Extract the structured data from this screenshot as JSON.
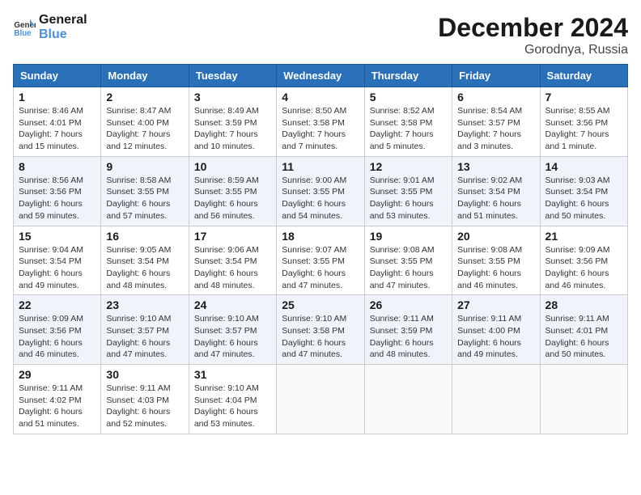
{
  "logo": {
    "line1": "General",
    "line2": "Blue"
  },
  "title": "December 2024",
  "location": "Gorodnya, Russia",
  "headers": [
    "Sunday",
    "Monday",
    "Tuesday",
    "Wednesday",
    "Thursday",
    "Friday",
    "Saturday"
  ],
  "weeks": [
    [
      {
        "day": "1",
        "info": "Sunrise: 8:46 AM\nSunset: 4:01 PM\nDaylight: 7 hours\nand 15 minutes."
      },
      {
        "day": "2",
        "info": "Sunrise: 8:47 AM\nSunset: 4:00 PM\nDaylight: 7 hours\nand 12 minutes."
      },
      {
        "day": "3",
        "info": "Sunrise: 8:49 AM\nSunset: 3:59 PM\nDaylight: 7 hours\nand 10 minutes."
      },
      {
        "day": "4",
        "info": "Sunrise: 8:50 AM\nSunset: 3:58 PM\nDaylight: 7 hours\nand 7 minutes."
      },
      {
        "day": "5",
        "info": "Sunrise: 8:52 AM\nSunset: 3:58 PM\nDaylight: 7 hours\nand 5 minutes."
      },
      {
        "day": "6",
        "info": "Sunrise: 8:54 AM\nSunset: 3:57 PM\nDaylight: 7 hours\nand 3 minutes."
      },
      {
        "day": "7",
        "info": "Sunrise: 8:55 AM\nSunset: 3:56 PM\nDaylight: 7 hours\nand 1 minute."
      }
    ],
    [
      {
        "day": "8",
        "info": "Sunrise: 8:56 AM\nSunset: 3:56 PM\nDaylight: 6 hours\nand 59 minutes."
      },
      {
        "day": "9",
        "info": "Sunrise: 8:58 AM\nSunset: 3:55 PM\nDaylight: 6 hours\nand 57 minutes."
      },
      {
        "day": "10",
        "info": "Sunrise: 8:59 AM\nSunset: 3:55 PM\nDaylight: 6 hours\nand 56 minutes."
      },
      {
        "day": "11",
        "info": "Sunrise: 9:00 AM\nSunset: 3:55 PM\nDaylight: 6 hours\nand 54 minutes."
      },
      {
        "day": "12",
        "info": "Sunrise: 9:01 AM\nSunset: 3:55 PM\nDaylight: 6 hours\nand 53 minutes."
      },
      {
        "day": "13",
        "info": "Sunrise: 9:02 AM\nSunset: 3:54 PM\nDaylight: 6 hours\nand 51 minutes."
      },
      {
        "day": "14",
        "info": "Sunrise: 9:03 AM\nSunset: 3:54 PM\nDaylight: 6 hours\nand 50 minutes."
      }
    ],
    [
      {
        "day": "15",
        "info": "Sunrise: 9:04 AM\nSunset: 3:54 PM\nDaylight: 6 hours\nand 49 minutes."
      },
      {
        "day": "16",
        "info": "Sunrise: 9:05 AM\nSunset: 3:54 PM\nDaylight: 6 hours\nand 48 minutes."
      },
      {
        "day": "17",
        "info": "Sunrise: 9:06 AM\nSunset: 3:54 PM\nDaylight: 6 hours\nand 48 minutes."
      },
      {
        "day": "18",
        "info": "Sunrise: 9:07 AM\nSunset: 3:55 PM\nDaylight: 6 hours\nand 47 minutes."
      },
      {
        "day": "19",
        "info": "Sunrise: 9:08 AM\nSunset: 3:55 PM\nDaylight: 6 hours\nand 47 minutes."
      },
      {
        "day": "20",
        "info": "Sunrise: 9:08 AM\nSunset: 3:55 PM\nDaylight: 6 hours\nand 46 minutes."
      },
      {
        "day": "21",
        "info": "Sunrise: 9:09 AM\nSunset: 3:56 PM\nDaylight: 6 hours\nand 46 minutes."
      }
    ],
    [
      {
        "day": "22",
        "info": "Sunrise: 9:09 AM\nSunset: 3:56 PM\nDaylight: 6 hours\nand 46 minutes."
      },
      {
        "day": "23",
        "info": "Sunrise: 9:10 AM\nSunset: 3:57 PM\nDaylight: 6 hours\nand 47 minutes."
      },
      {
        "day": "24",
        "info": "Sunrise: 9:10 AM\nSunset: 3:57 PM\nDaylight: 6 hours\nand 47 minutes."
      },
      {
        "day": "25",
        "info": "Sunrise: 9:10 AM\nSunset: 3:58 PM\nDaylight: 6 hours\nand 47 minutes."
      },
      {
        "day": "26",
        "info": "Sunrise: 9:11 AM\nSunset: 3:59 PM\nDaylight: 6 hours\nand 48 minutes."
      },
      {
        "day": "27",
        "info": "Sunrise: 9:11 AM\nSunset: 4:00 PM\nDaylight: 6 hours\nand 49 minutes."
      },
      {
        "day": "28",
        "info": "Sunrise: 9:11 AM\nSunset: 4:01 PM\nDaylight: 6 hours\nand 50 minutes."
      }
    ],
    [
      {
        "day": "29",
        "info": "Sunrise: 9:11 AM\nSunset: 4:02 PM\nDaylight: 6 hours\nand 51 minutes."
      },
      {
        "day": "30",
        "info": "Sunrise: 9:11 AM\nSunset: 4:03 PM\nDaylight: 6 hours\nand 52 minutes."
      },
      {
        "day": "31",
        "info": "Sunrise: 9:10 AM\nSunset: 4:04 PM\nDaylight: 6 hours\nand 53 minutes."
      },
      {
        "day": "",
        "info": ""
      },
      {
        "day": "",
        "info": ""
      },
      {
        "day": "",
        "info": ""
      },
      {
        "day": "",
        "info": ""
      }
    ]
  ]
}
